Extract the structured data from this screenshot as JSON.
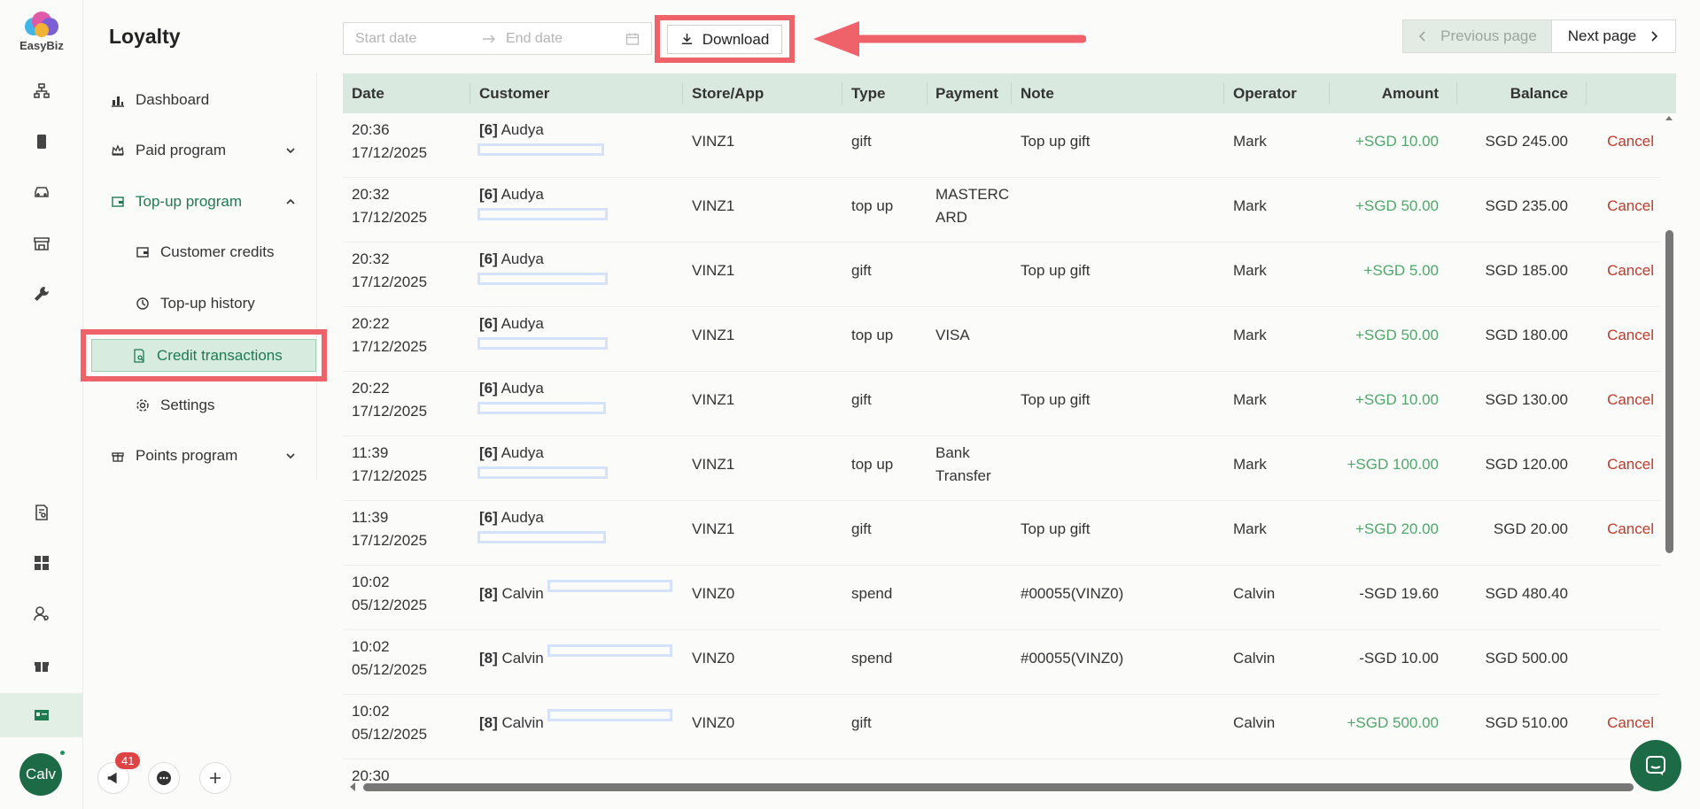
{
  "app": {
    "logo_text": "EasyBiz"
  },
  "sidebar": {
    "title": "Loyalty",
    "items": [
      {
        "label": "Dashboard"
      },
      {
        "label": "Paid program"
      },
      {
        "label": "Top-up program"
      },
      {
        "label": "Customer credits"
      },
      {
        "label": "Top-up history"
      },
      {
        "label": "Credit transactions"
      },
      {
        "label": "Settings"
      },
      {
        "label": "Points program"
      }
    ]
  },
  "rail": {
    "avatar_label": "Calv",
    "notification_count": "41"
  },
  "toolbar": {
    "start_placeholder": "Start date",
    "end_placeholder": "End date",
    "download_label": "Download",
    "prev_label": "Previous page",
    "next_label": "Next page"
  },
  "table": {
    "headers": [
      "Date",
      "Customer",
      "Store/App",
      "Type",
      "Payment",
      "Note",
      "Operator",
      "Amount",
      "Balance"
    ],
    "rows": [
      {
        "time": "20:36",
        "date": "17/12/2025",
        "cid": "[6]",
        "cname": "Audya",
        "store": "VINZ1",
        "type": "gift",
        "pay1": "",
        "pay2": "",
        "note": "Top up gift",
        "op": "Mark",
        "amount": "+SGD 10.00",
        "balance": "SGD 245.00",
        "action": "Cancel"
      },
      {
        "time": "20:32",
        "date": "17/12/2025",
        "cid": "[6]",
        "cname": "Audya",
        "store": "VINZ1",
        "type": "top up",
        "pay1": "MASTERC",
        "pay2": "ARD",
        "note": "",
        "op": "Mark",
        "amount": "+SGD 50.00",
        "balance": "SGD 235.00",
        "action": "Cancel"
      },
      {
        "time": "20:32",
        "date": "17/12/2025",
        "cid": "[6]",
        "cname": "Audya",
        "store": "VINZ1",
        "type": "gift",
        "pay1": "",
        "pay2": "",
        "note": "Top up gift",
        "op": "Mark",
        "amount": "+SGD 5.00",
        "balance": "SGD 185.00",
        "action": "Cancel"
      },
      {
        "time": "20:22",
        "date": "17/12/2025",
        "cid": "[6]",
        "cname": "Audya",
        "store": "VINZ1",
        "type": "top up",
        "pay1": "VISA",
        "pay2": "",
        "note": "",
        "op": "Mark",
        "amount": "+SGD 50.00",
        "balance": "SGD 180.00",
        "action": "Cancel"
      },
      {
        "time": "20:22",
        "date": "17/12/2025",
        "cid": "[6]",
        "cname": "Audya",
        "store": "VINZ1",
        "type": "gift",
        "pay1": "",
        "pay2": "",
        "note": "Top up gift",
        "op": "Mark",
        "amount": "+SGD 10.00",
        "balance": "SGD 130.00",
        "action": "Cancel"
      },
      {
        "time": "11:39",
        "date": "17/12/2025",
        "cid": "[6]",
        "cname": "Audya",
        "store": "VINZ1",
        "type": "top up",
        "pay1": "Bank",
        "pay2": "Transfer",
        "note": "",
        "op": "Mark",
        "amount": "+SGD 100.00",
        "balance": "SGD 120.00",
        "action": "Cancel"
      },
      {
        "time": "11:39",
        "date": "17/12/2025",
        "cid": "[6]",
        "cname": "Audya",
        "store": "VINZ1",
        "type": "gift",
        "pay1": "",
        "pay2": "",
        "note": "Top up gift",
        "op": "Mark",
        "amount": "+SGD 20.00",
        "balance": "SGD 20.00",
        "action": "Cancel"
      },
      {
        "time": "10:02",
        "date": "05/12/2025",
        "cid": "[8]",
        "cname": "Calvin",
        "store": "VINZ0",
        "type": "spend",
        "pay1": "",
        "pay2": "",
        "note": "#00055(VINZ0)",
        "op": "Calvin",
        "amount": "-SGD 19.60",
        "balance": "SGD 480.40",
        "action": ""
      },
      {
        "time": "10:02",
        "date": "05/12/2025",
        "cid": "[8]",
        "cname": "Calvin",
        "store": "VINZ0",
        "type": "spend",
        "pay1": "",
        "pay2": "",
        "note": "#00055(VINZ0)",
        "op": "Calvin",
        "amount": "-SGD 10.00",
        "balance": "SGD 500.00",
        "action": ""
      },
      {
        "time": "10:02",
        "date": "05/12/2025",
        "cid": "[8]",
        "cname": "Calvin",
        "store": "VINZ0",
        "type": "gift",
        "pay1": "",
        "pay2": "",
        "note": "",
        "op": "Calvin",
        "amount": "+SGD 500.00",
        "balance": "SGD 510.00",
        "action": "Cancel"
      },
      {
        "time": "20:30",
        "date": "",
        "cid": "",
        "cname": "",
        "store": "",
        "type": "",
        "pay1": "",
        "pay2": "",
        "note": "",
        "op": "",
        "amount": "",
        "balance": "",
        "action": ""
      }
    ]
  },
  "colors": {
    "brand": "#1d6b46",
    "positive": "#4fa66a",
    "cancel": "#c0392b",
    "highlight": "#f0626a",
    "header_bg": "#d9e9df"
  }
}
